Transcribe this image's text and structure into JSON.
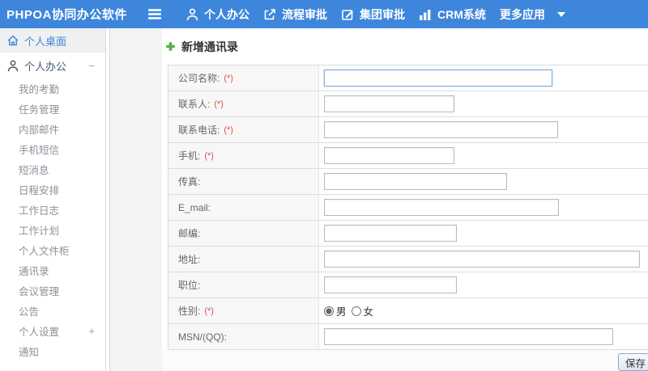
{
  "colors": {
    "topbar_blue": "#3d86dc",
    "accent_blue": "#3e86d8",
    "plus_green": "#54b44a",
    "required_red": "#e04f4f"
  },
  "topbar": {
    "logo": "PHPOA协同办公软件",
    "nav": [
      {
        "id": "personal-office",
        "label": "个人办公",
        "icon": "person-icon"
      },
      {
        "id": "workflow-approval",
        "label": "流程审批",
        "icon": "flow-icon"
      },
      {
        "id": "group-approval",
        "label": "集团审批",
        "icon": "edit-icon"
      },
      {
        "id": "crm-system",
        "label": "CRM系统",
        "icon": "chart-icon"
      },
      {
        "id": "more-apps",
        "label": "更多应用",
        "icon": null,
        "caret": true
      }
    ]
  },
  "sidebar": {
    "items": [
      {
        "label": "个人桌面",
        "type": "top",
        "icon": "home-icon"
      },
      {
        "label": "个人办公",
        "type": "group",
        "icon": "user-icon",
        "expander": "−"
      },
      {
        "label": "我的考勤",
        "type": "sub"
      },
      {
        "label": "任务管理",
        "type": "sub"
      },
      {
        "label": "内部邮件",
        "type": "sub"
      },
      {
        "label": "手机短信",
        "type": "sub"
      },
      {
        "label": "短消息",
        "type": "sub"
      },
      {
        "label": "日程安排",
        "type": "sub"
      },
      {
        "label": "工作日志",
        "type": "sub"
      },
      {
        "label": "工作计划",
        "type": "sub"
      },
      {
        "label": "个人文件柜",
        "type": "sub"
      },
      {
        "label": "通讯录",
        "type": "sub"
      },
      {
        "label": "会议管理",
        "type": "sub"
      },
      {
        "label": "公告",
        "type": "sub"
      },
      {
        "label": "个人设置",
        "type": "sub",
        "expander": "+"
      },
      {
        "label": "通知",
        "type": "sub"
      }
    ]
  },
  "main": {
    "title": "新增通讯录",
    "form": {
      "required_marker": "(*)",
      "save_label": "保存",
      "rows": [
        {
          "name": "company-name",
          "label": "公司名称:",
          "required": true,
          "type": "text",
          "input_width": 282,
          "value": "",
          "focused": true
        },
        {
          "name": "contact-person",
          "label": "联系人:",
          "required": true,
          "type": "text",
          "input_width": 161,
          "value": ""
        },
        {
          "name": "contact-phone",
          "label": "联系电话:",
          "required": true,
          "type": "text",
          "input_width": 289,
          "value": ""
        },
        {
          "name": "mobile",
          "label": "手机:",
          "required": true,
          "type": "text",
          "input_width": 161,
          "value": ""
        },
        {
          "name": "fax",
          "label": "传真:",
          "required": false,
          "type": "text",
          "input_width": 226,
          "value": ""
        },
        {
          "name": "email",
          "label": "E_mail:",
          "required": false,
          "type": "text",
          "input_width": 290,
          "value": ""
        },
        {
          "name": "zipcode",
          "label": "邮编:",
          "required": false,
          "type": "text",
          "input_width": 164,
          "value": ""
        },
        {
          "name": "address",
          "label": "地址:",
          "required": false,
          "type": "text",
          "input_width": 400,
          "value": ""
        },
        {
          "name": "position",
          "label": "职位:",
          "required": false,
          "type": "text",
          "input_width": 164,
          "value": ""
        },
        {
          "name": "gender",
          "label": "性别:",
          "required": true,
          "type": "radio",
          "options": [
            "男",
            "女"
          ],
          "option_names": [
            "male",
            "female"
          ],
          "selected": "男"
        },
        {
          "name": "msn-qq",
          "label": "MSN/(QQ):",
          "required": false,
          "type": "text",
          "input_width": 357,
          "value": ""
        }
      ]
    }
  }
}
